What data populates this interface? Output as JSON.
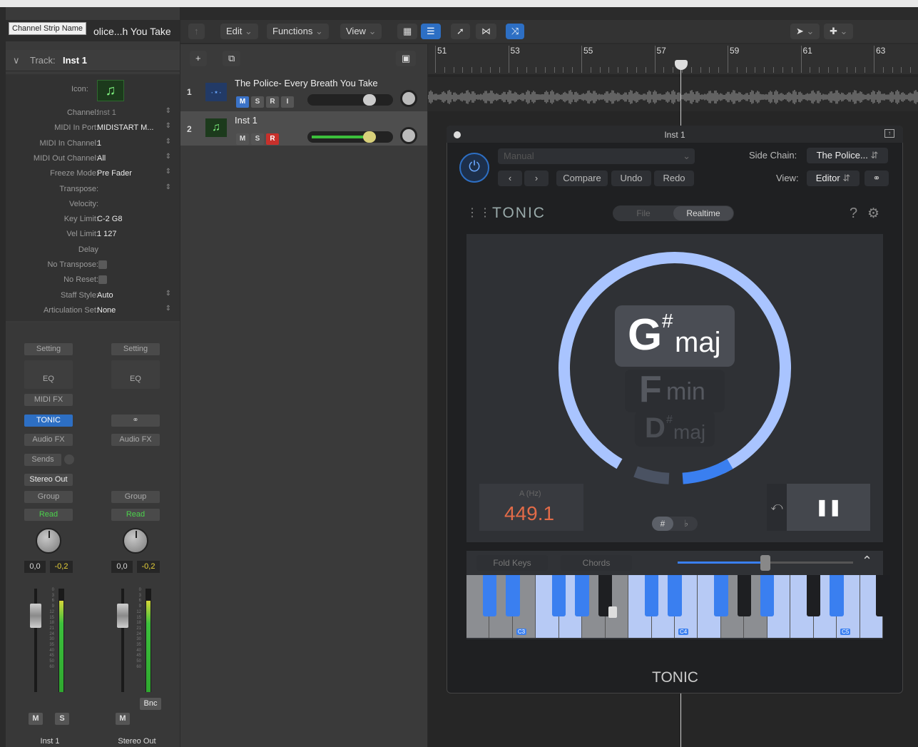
{
  "window": {
    "tooltip": "Channel Strip Name",
    "region_title": "olice...h You Take"
  },
  "inspector": {
    "track_label": "Track:",
    "track_name": "Inst 1",
    "icon_label": "Icon:",
    "params": [
      {
        "label": "Channel:",
        "value": "Inst 1",
        "dim": true
      },
      {
        "label": "MIDI In Port:",
        "value": "MIDISTART M..."
      },
      {
        "label": "MIDI In Channel:",
        "value": "1"
      },
      {
        "label": "MIDI Out Channel:",
        "value": "All"
      },
      {
        "label": "Freeze Mode:",
        "value": "Pre Fader"
      },
      {
        "label": "Transpose:",
        "value": ""
      },
      {
        "label": "Velocity:",
        "value": ""
      },
      {
        "label": "Key Limit:",
        "value": "C-2  G8"
      },
      {
        "label": "Vel Limit:",
        "value": "1  127"
      },
      {
        "label": "Delay",
        "value": ""
      },
      {
        "label": "No Transpose:",
        "value": ""
      },
      {
        "label": "No Reset:",
        "value": ""
      },
      {
        "label": "Staff Style:",
        "value": "Auto"
      },
      {
        "label": "Articulation Set:",
        "value": "None"
      }
    ]
  },
  "strips": [
    {
      "setting": "Setting",
      "eq": "EQ",
      "midifx": "MIDI FX",
      "plugin": "TONIC",
      "audiofx": "Audio FX",
      "sends": "Sends",
      "output": "Stereo Out",
      "group": "Group",
      "automation": "Read",
      "vol": "0,0",
      "peak": "-0,2",
      "m": "M",
      "s": "S",
      "name": "Inst 1"
    },
    {
      "setting": "Setting",
      "eq": "EQ",
      "link": "⚭",
      "audiofx": "Audio FX",
      "group": "Group",
      "automation": "Read",
      "vol": "0,0",
      "peak": "-0,2",
      "m": "M",
      "bnc": "Bnc",
      "name": "Stereo Out"
    }
  ],
  "meter_scale": [
    "0",
    "3",
    "6",
    "9",
    "12",
    "15",
    "18",
    "21",
    "24",
    "30",
    "35",
    "40",
    "45",
    "50",
    "60"
  ],
  "toolbar": {
    "edit": "Edit",
    "functions": "Functions",
    "view": "View"
  },
  "tracks": [
    {
      "num": "1",
      "name": "The Police- Every Breath You Take",
      "m": "M",
      "s": "S",
      "r": "R",
      "i": "I"
    },
    {
      "num": "2",
      "name": "Inst 1",
      "m": "M",
      "s": "S",
      "r": "R"
    }
  ],
  "ruler": [
    "51",
    "53",
    "55",
    "57",
    "59",
    "61",
    "63"
  ],
  "plugin": {
    "title": "Inst 1",
    "preset": "Manual",
    "compare": "Compare",
    "undo": "Undo",
    "redo": "Redo",
    "sidechain_label": "Side Chain:",
    "sidechain_value": "The Police...",
    "view_label": "View:",
    "view_value": "Editor",
    "brand": "TONIC",
    "tab_file": "File",
    "tab_realtime": "Realtime",
    "chord1_root": "G",
    "chord1_acc": "#",
    "chord1_q": "maj",
    "chord2_root": "F",
    "chord2_q": "min",
    "chord3_root": "D",
    "chord3_acc": "#",
    "chord3_q": "maj",
    "a_label": "A (Hz)",
    "a_value": "449.1",
    "sharp": "#",
    "flat": "♭",
    "fold_keys": "Fold Keys",
    "chords": "Chords",
    "oct": [
      "C3",
      "C4",
      "C5"
    ],
    "footer": "TONIC"
  }
}
